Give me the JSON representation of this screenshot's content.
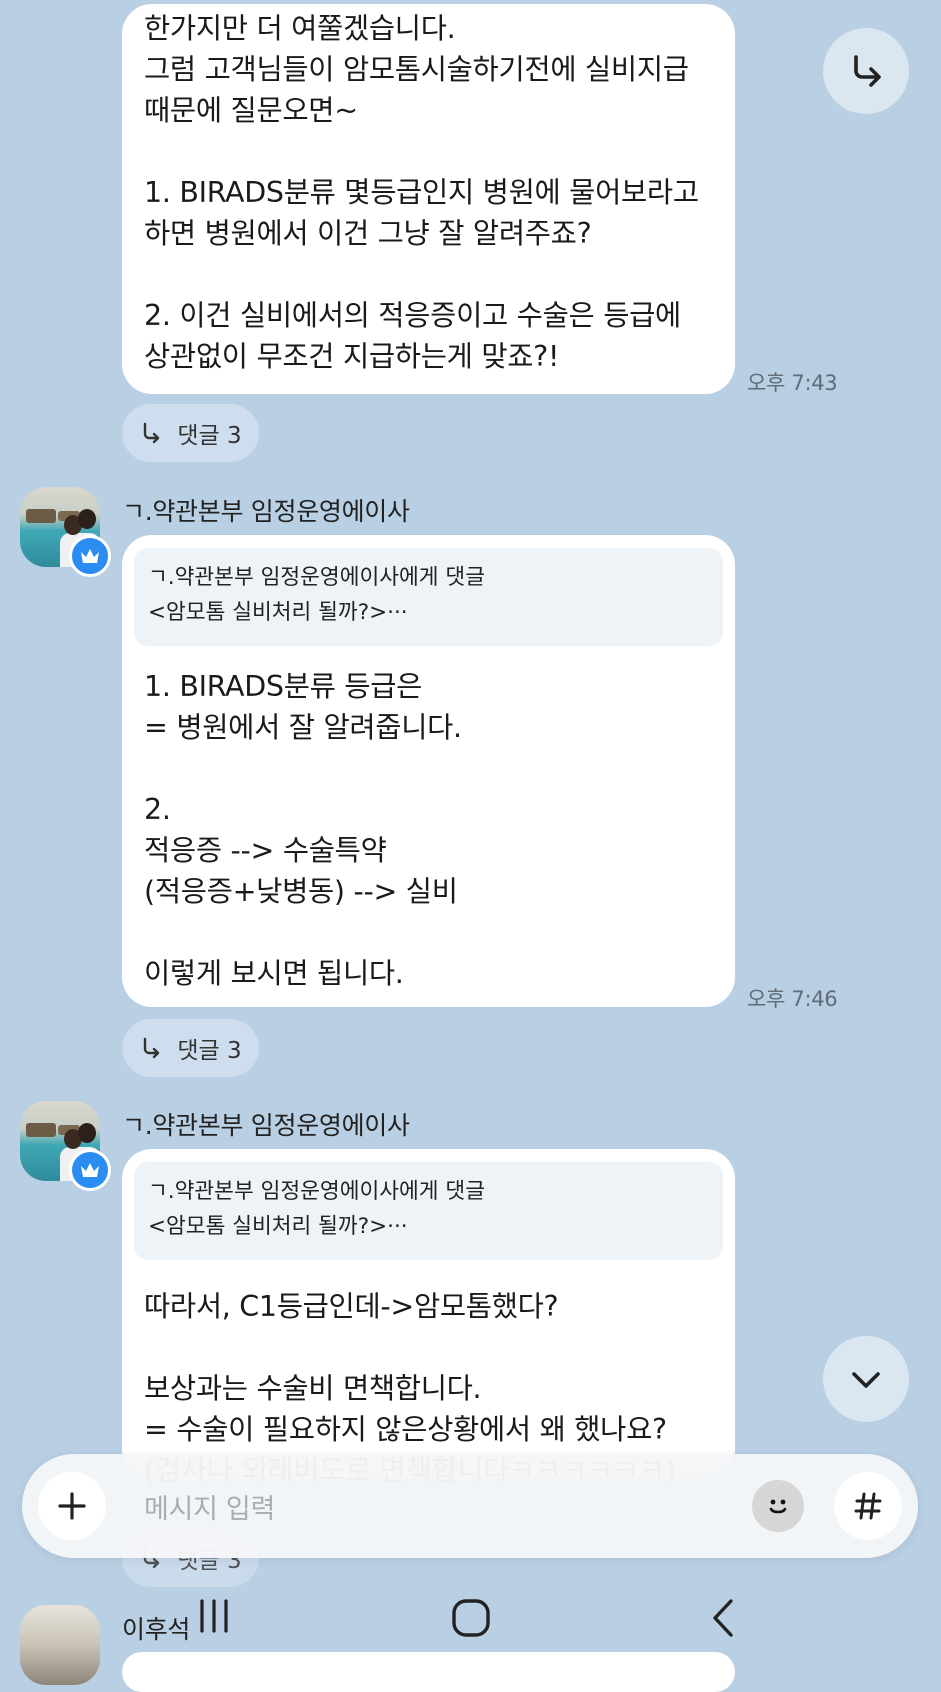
{
  "messages": [
    {
      "text": "한가지만 더 여쭐겠습니다.\n그럼 고객님들이 암모톰시술하기전에 실비지급\n때문에 질문오면~\n\n1. BIRADS분류 몇등급인지 병원에 물어보라고\n하면 병원에서 이건 그냥 잘 알려주죠?\n\n2. 이건 실비에서의 적응증이고 수술은 등급에\n상관없이 무조건 지급하는게 맞죠?!",
      "time": "오후 7:43",
      "reply_label": "댓글 3"
    },
    {
      "sender": "ㄱ.약관본부 임정운영에이사",
      "quote_title": "ㄱ.약관본부 임정운영에이사에게 댓글",
      "quote_preview": "<암모톰 실비처리 될까?>···",
      "text": "1. BIRADS분류 등급은\n= 병원에서 잘 알려줍니다.\n\n2.\n적응증 --> 수술특약\n(적응증+낮병동) --> 실비\n\n이렇게 보시면 됩니다.",
      "time": "오후 7:46",
      "reply_label": "댓글 3"
    },
    {
      "sender": "ㄱ.약관본부 임정운영에이사",
      "quote_title": "ㄱ.약관본부 임정운영에이사에게 댓글",
      "quote_preview": "<암모톰 실비처리 될까?>···",
      "text": "따라서, C1등급인데->암모톰했다?\n\n보상과는 수술비 면책합니다.\n= 수술이 필요하지 않은상황에서 왜 했나요?\n(검사나 외래비도로 면책합니다ㅋㅋㅋㅋㅋㅋ)",
      "reply_label": "댓글 3"
    },
    {
      "sender": "이후석"
    }
  ],
  "input": {
    "placeholder": "메시지 입력"
  },
  "icons": {
    "share": "share-arrow-icon",
    "scroll_down": "chevron-down-icon",
    "add": "plus-icon",
    "emoji": "emoji-icon",
    "hashtag": "hashtag-icon",
    "badge": "crown-icon",
    "nav": [
      "recent-apps-icon",
      "home-icon",
      "back-icon"
    ]
  },
  "colors": {
    "background": "#b9cfe3",
    "bubble": "#ffffff",
    "badge": "#2b8df1"
  }
}
